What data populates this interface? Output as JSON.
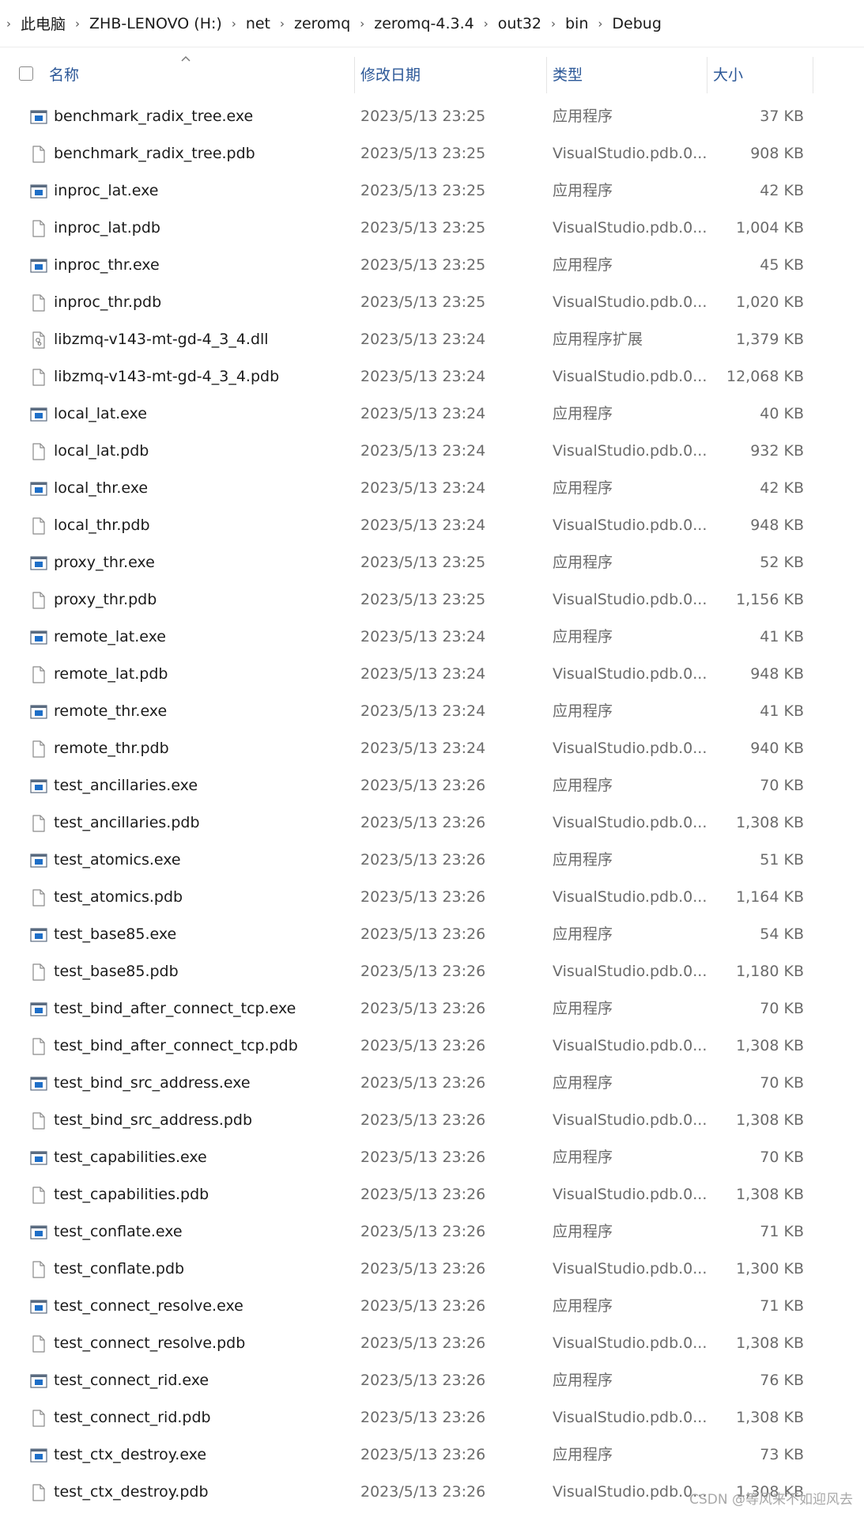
{
  "breadcrumb": [
    "此电脑",
    "ZHB-LENOVO (H:)",
    "net",
    "zeromq",
    "zeromq-4.3.4",
    "out32",
    "bin",
    "Debug"
  ],
  "columns": {
    "name": "名称",
    "date": "修改日期",
    "type": "类型",
    "size": "大小"
  },
  "files": [
    {
      "name": "benchmark_radix_tree.exe",
      "date": "2023/5/13 23:25",
      "type": "应用程序",
      "size": "37 KB",
      "icon": "exe-icon"
    },
    {
      "name": "benchmark_radix_tree.pdb",
      "date": "2023/5/13 23:25",
      "type": "VisualStudio.pdb.0...",
      "size": "908 KB",
      "icon": "file-icon"
    },
    {
      "name": "inproc_lat.exe",
      "date": "2023/5/13 23:25",
      "type": "应用程序",
      "size": "42 KB",
      "icon": "exe-icon"
    },
    {
      "name": "inproc_lat.pdb",
      "date": "2023/5/13 23:25",
      "type": "VisualStudio.pdb.0...",
      "size": "1,004 KB",
      "icon": "file-icon"
    },
    {
      "name": "inproc_thr.exe",
      "date": "2023/5/13 23:25",
      "type": "应用程序",
      "size": "45 KB",
      "icon": "exe-icon"
    },
    {
      "name": "inproc_thr.pdb",
      "date": "2023/5/13 23:25",
      "type": "VisualStudio.pdb.0...",
      "size": "1,020 KB",
      "icon": "file-icon"
    },
    {
      "name": "libzmq-v143-mt-gd-4_3_4.dll",
      "date": "2023/5/13 23:24",
      "type": "应用程序扩展",
      "size": "1,379 KB",
      "icon": "dll-icon"
    },
    {
      "name": "libzmq-v143-mt-gd-4_3_4.pdb",
      "date": "2023/5/13 23:24",
      "type": "VisualStudio.pdb.0...",
      "size": "12,068 KB",
      "icon": "file-icon"
    },
    {
      "name": "local_lat.exe",
      "date": "2023/5/13 23:24",
      "type": "应用程序",
      "size": "40 KB",
      "icon": "exe-icon"
    },
    {
      "name": "local_lat.pdb",
      "date": "2023/5/13 23:24",
      "type": "VisualStudio.pdb.0...",
      "size": "932 KB",
      "icon": "file-icon"
    },
    {
      "name": "local_thr.exe",
      "date": "2023/5/13 23:24",
      "type": "应用程序",
      "size": "42 KB",
      "icon": "exe-icon"
    },
    {
      "name": "local_thr.pdb",
      "date": "2023/5/13 23:24",
      "type": "VisualStudio.pdb.0...",
      "size": "948 KB",
      "icon": "file-icon"
    },
    {
      "name": "proxy_thr.exe",
      "date": "2023/5/13 23:25",
      "type": "应用程序",
      "size": "52 KB",
      "icon": "exe-icon"
    },
    {
      "name": "proxy_thr.pdb",
      "date": "2023/5/13 23:25",
      "type": "VisualStudio.pdb.0...",
      "size": "1,156 KB",
      "icon": "file-icon"
    },
    {
      "name": "remote_lat.exe",
      "date": "2023/5/13 23:24",
      "type": "应用程序",
      "size": "41 KB",
      "icon": "exe-icon"
    },
    {
      "name": "remote_lat.pdb",
      "date": "2023/5/13 23:24",
      "type": "VisualStudio.pdb.0...",
      "size": "948 KB",
      "icon": "file-icon"
    },
    {
      "name": "remote_thr.exe",
      "date": "2023/5/13 23:24",
      "type": "应用程序",
      "size": "41 KB",
      "icon": "exe-icon"
    },
    {
      "name": "remote_thr.pdb",
      "date": "2023/5/13 23:24",
      "type": "VisualStudio.pdb.0...",
      "size": "940 KB",
      "icon": "file-icon"
    },
    {
      "name": "test_ancillaries.exe",
      "date": "2023/5/13 23:26",
      "type": "应用程序",
      "size": "70 KB",
      "icon": "exe-icon"
    },
    {
      "name": "test_ancillaries.pdb",
      "date": "2023/5/13 23:26",
      "type": "VisualStudio.pdb.0...",
      "size": "1,308 KB",
      "icon": "file-icon"
    },
    {
      "name": "test_atomics.exe",
      "date": "2023/5/13 23:26",
      "type": "应用程序",
      "size": "51 KB",
      "icon": "exe-icon"
    },
    {
      "name": "test_atomics.pdb",
      "date": "2023/5/13 23:26",
      "type": "VisualStudio.pdb.0...",
      "size": "1,164 KB",
      "icon": "file-icon"
    },
    {
      "name": "test_base85.exe",
      "date": "2023/5/13 23:26",
      "type": "应用程序",
      "size": "54 KB",
      "icon": "exe-icon"
    },
    {
      "name": "test_base85.pdb",
      "date": "2023/5/13 23:26",
      "type": "VisualStudio.pdb.0...",
      "size": "1,180 KB",
      "icon": "file-icon"
    },
    {
      "name": "test_bind_after_connect_tcp.exe",
      "date": "2023/5/13 23:26",
      "type": "应用程序",
      "size": "70 KB",
      "icon": "exe-icon"
    },
    {
      "name": "test_bind_after_connect_tcp.pdb",
      "date": "2023/5/13 23:26",
      "type": "VisualStudio.pdb.0...",
      "size": "1,308 KB",
      "icon": "file-icon"
    },
    {
      "name": "test_bind_src_address.exe",
      "date": "2023/5/13 23:26",
      "type": "应用程序",
      "size": "70 KB",
      "icon": "exe-icon"
    },
    {
      "name": "test_bind_src_address.pdb",
      "date": "2023/5/13 23:26",
      "type": "VisualStudio.pdb.0...",
      "size": "1,308 KB",
      "icon": "file-icon"
    },
    {
      "name": "test_capabilities.exe",
      "date": "2023/5/13 23:26",
      "type": "应用程序",
      "size": "70 KB",
      "icon": "exe-icon"
    },
    {
      "name": "test_capabilities.pdb",
      "date": "2023/5/13 23:26",
      "type": "VisualStudio.pdb.0...",
      "size": "1,308 KB",
      "icon": "file-icon"
    },
    {
      "name": "test_conflate.exe",
      "date": "2023/5/13 23:26",
      "type": "应用程序",
      "size": "71 KB",
      "icon": "exe-icon"
    },
    {
      "name": "test_conflate.pdb",
      "date": "2023/5/13 23:26",
      "type": "VisualStudio.pdb.0...",
      "size": "1,300 KB",
      "icon": "file-icon"
    },
    {
      "name": "test_connect_resolve.exe",
      "date": "2023/5/13 23:26",
      "type": "应用程序",
      "size": "71 KB",
      "icon": "exe-icon"
    },
    {
      "name": "test_connect_resolve.pdb",
      "date": "2023/5/13 23:26",
      "type": "VisualStudio.pdb.0...",
      "size": "1,308 KB",
      "icon": "file-icon"
    },
    {
      "name": "test_connect_rid.exe",
      "date": "2023/5/13 23:26",
      "type": "应用程序",
      "size": "76 KB",
      "icon": "exe-icon"
    },
    {
      "name": "test_connect_rid.pdb",
      "date": "2023/5/13 23:26",
      "type": "VisualStudio.pdb.0...",
      "size": "1,308 KB",
      "icon": "file-icon"
    },
    {
      "name": "test_ctx_destroy.exe",
      "date": "2023/5/13 23:26",
      "type": "应用程序",
      "size": "73 KB",
      "icon": "exe-icon"
    },
    {
      "name": "test_ctx_destroy.pdb",
      "date": "2023/5/13 23:26",
      "type": "VisualStudio.pdb.0...",
      "size": "1,308 KB",
      "icon": "file-icon"
    }
  ],
  "watermark": "CSDN @等风来不如迎风去",
  "colors": {
    "header_text": "#2b5797",
    "exe_icon_blue": "#1e6fc8",
    "secondary_text": "#6b6b6b"
  }
}
